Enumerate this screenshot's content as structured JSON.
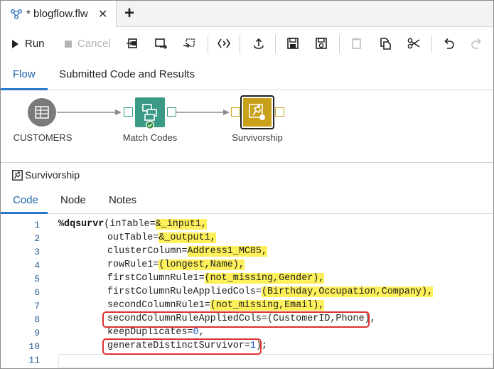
{
  "tab": {
    "title": "* blogflow.flw",
    "close": "✕",
    "add": "+"
  },
  "toolbar": {
    "run_label": "Run",
    "cancel_label": "Cancel"
  },
  "main_tabs": [
    {
      "label": "Flow"
    },
    {
      "label": "Submitted Code and Results"
    }
  ],
  "flow": {
    "nodes": [
      {
        "label": "CUSTOMERS"
      },
      {
        "label": "Match Codes"
      },
      {
        "label": "Survivorship"
      }
    ],
    "colors": {
      "table_node": "#7a7a7a",
      "match_node": "#3a9a86",
      "surv_node": "#c9a01a",
      "port_green": "#3a9a86",
      "port_gold": "#c9a01a",
      "status_ok": "#2e8b3a"
    }
  },
  "details": {
    "title": "Survivorship",
    "tabs": [
      {
        "label": "Code"
      },
      {
        "label": "Node"
      },
      {
        "label": "Notes"
      }
    ]
  },
  "code": {
    "line_numbers": [
      "1",
      "2",
      "3",
      "4",
      "5",
      "6",
      "7",
      "8",
      "9",
      "10",
      "11"
    ],
    "lines": [
      {
        "a": "%dqsurvr",
        "b": "(inTable=",
        "c": "&_input1",
        "d": ","
      },
      {
        "a": "outTable=",
        "b": "&_output1",
        "c": ","
      },
      {
        "a": "clusterColumn=",
        "b": "Address1_MC85",
        "c": ","
      },
      {
        "a": "rowRule1=",
        "b": "(longest,Name)",
        "c": ","
      },
      {
        "a": "firstColumnRule1=",
        "b": "(not_missing,Gender)",
        "c": ","
      },
      {
        "a": "firstColumnRuleAppliedCols=",
        "b": "(Birthday,Occupation,Company)",
        "c": ","
      },
      {
        "a": "secondColumnRule1=",
        "b": "(not_missing,Email)",
        "c": ","
      },
      {
        "a": "secondColumnRuleAppliedCols=(CustomerID,Phone),"
      },
      {
        "a": "keepDuplicates=",
        "b": "0",
        "c": ","
      },
      {
        "a": "generateDistinctSurvivor=",
        "b": "1",
        "c": ");"
      },
      {
        "a": ""
      }
    ]
  }
}
